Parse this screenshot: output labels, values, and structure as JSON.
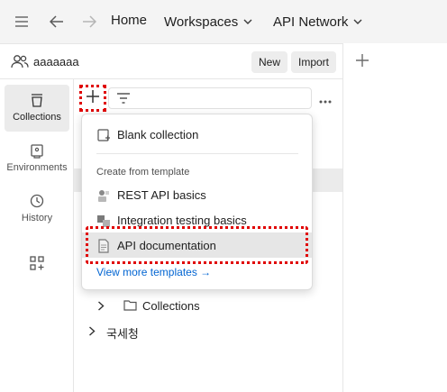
{
  "topbar": {
    "home": "Home",
    "workspaces": "Workspaces",
    "api_network": "API Network"
  },
  "workspace": {
    "name": "aaaaaaa",
    "new_label": "New",
    "import_label": "Import"
  },
  "rail": {
    "items": [
      {
        "label": "Collections"
      },
      {
        "label": "Environments"
      },
      {
        "label": "History"
      }
    ]
  },
  "menu": {
    "blank": "Blank collection",
    "template_heading": "Create from template",
    "templates": [
      "REST API basics",
      "Integration testing basics",
      "API documentation"
    ],
    "view_more": "View more templates →"
  },
  "tree": {
    "collections_folder": "Collections",
    "korean_item": "국세청"
  }
}
